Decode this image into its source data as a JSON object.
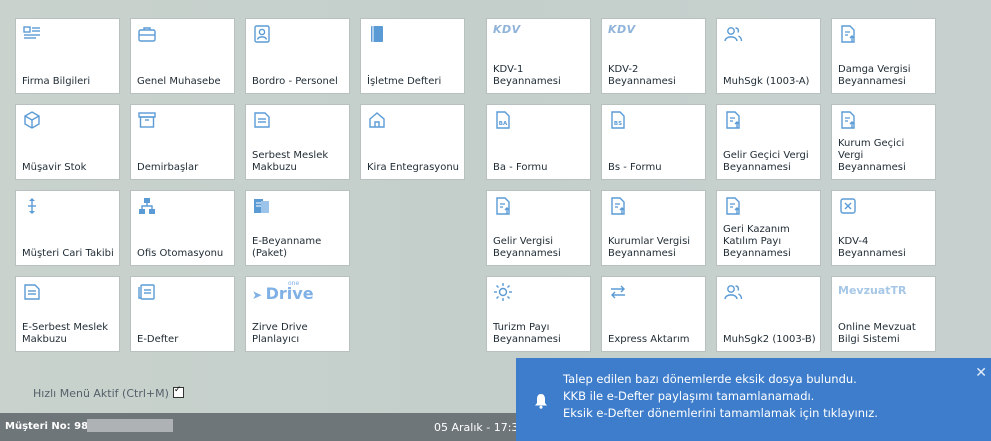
{
  "tiles_left": [
    {
      "name": "firma-bilgileri",
      "label": "Firma Bilgileri",
      "icon": "list-icon"
    },
    {
      "name": "genel-muhasebe",
      "label": "Genel Muhasebe",
      "icon": "briefcase-icon"
    },
    {
      "name": "bordro-personel",
      "label": "Bordro - Personel",
      "icon": "person-card-icon"
    },
    {
      "name": "isletme-defteri",
      "label": "İşletme Defteri",
      "icon": "notebook-icon"
    },
    {
      "name": "musavir-stok",
      "label": "Müşavir Stok",
      "icon": "box-icon"
    },
    {
      "name": "demirbaslar",
      "label": "Demirbaşlar",
      "icon": "archive-icon"
    },
    {
      "name": "serbest-meslek-makbuzu",
      "label": "Serbest Meslek\nMakbuzu",
      "icon": "receipt-icon"
    },
    {
      "name": "kira-entegrasyonu",
      "label": "Kira Entegrasyonu",
      "icon": "house-icon"
    },
    {
      "name": "musteri-cari-takibi",
      "label": "Müşteri Cari Takibi",
      "icon": "updown-arrows-icon"
    },
    {
      "name": "ofis-otomasyonu",
      "label": "Ofis Otomasyonu",
      "icon": "org-chart-icon"
    },
    {
      "name": "e-beyanname-paket",
      "label": "E-Beyanname\n(Paket)",
      "icon": "document-bundle-icon"
    },
    {
      "name": "e-serbest-meslek-makbuzu",
      "label": "E-Serbest Meslek\nMakbuzu",
      "icon": "receipt-icon"
    },
    {
      "name": "e-defter",
      "label": "E-Defter",
      "icon": "ledger-icon"
    },
    {
      "name": "zirve-drive-planlayici",
      "label": "Zirve Drive\nPlanlayıcı",
      "icon": "drive-logo",
      "logo_text": "Drive",
      "logo_small": "one"
    }
  ],
  "tiles_right": [
    {
      "name": "kdv-1-beyannamesi",
      "label": "KDV-1\nBeyannamesi",
      "icon": "kdv-logo",
      "logo_text": "KDV"
    },
    {
      "name": "kdv-2-beyannamesi",
      "label": "KDV-2\nBeyannamesi",
      "icon": "kdv-logo",
      "logo_text": "KDV"
    },
    {
      "name": "muhsgk-1003-a",
      "label": "MuhSgk (1003-A)",
      "icon": "people-icon"
    },
    {
      "name": "damga-vergisi-beyannamesi",
      "label": "Damga Vergisi\nBeyannamesi",
      "icon": "document-upload-icon"
    },
    {
      "name": "ba-formu",
      "label": "Ba - Formu",
      "icon": "ba-document-icon"
    },
    {
      "name": "bs-formu",
      "label": "Bs - Formu",
      "icon": "bs-document-icon"
    },
    {
      "name": "gelir-gecici-vergi",
      "label": "Gelir Geçici Vergi\nBeyannamesi",
      "icon": "document-upload-icon"
    },
    {
      "name": "kurum-gecici-vergi",
      "label": "Kurum Geçici Vergi\nBeyannamesi",
      "icon": "document-upload-icon"
    },
    {
      "name": "gelir-vergisi-beyannamesi",
      "label": "Gelir Vergisi\nBeyannamesi",
      "icon": "document-upload-icon"
    },
    {
      "name": "kurumlar-vergisi-beyannamesi",
      "label": "Kurumlar Vergisi\nBeyannamesi",
      "icon": "document-upload-icon"
    },
    {
      "name": "geri-kazanim-katilim-payi",
      "label": "Geri Kazanım\nKatılım Payı\nBeyannamesi",
      "icon": "document-upload-icon"
    },
    {
      "name": "kdv-4-beyannamesi",
      "label": "KDV-4\nBeyannamesi",
      "icon": "chip-icon"
    },
    {
      "name": "turizm-payi-beyannamesi",
      "label": "Turizm Payı\nBeyannamesi",
      "icon": "sun-icon"
    },
    {
      "name": "express-aktarim",
      "label": "Express Aktarım",
      "icon": "transfer-arrows-icon"
    },
    {
      "name": "muhsgk2-1003-b",
      "label": "MuhSgk2 (1003-B)",
      "icon": "people-icon"
    },
    {
      "name": "online-mevzuat",
      "label": "Online Mevzuat\nBilgi Sistemi",
      "icon": "mevzuat-logo",
      "logo_text": "MevzuatTR"
    }
  ],
  "hizli_menu": {
    "label": "Hızlı Menü Aktif (Ctrl+M)",
    "checked": true
  },
  "statusbar": {
    "musteri_label": "Müşteri No: 98",
    "date": "05 Aralık - 17:3"
  },
  "toast": {
    "lines": [
      "Talep edilen bazı dönemlerde eksik dosya bulundu.",
      "KKB ile e-Defter paylaşımı tamamlanamadı.",
      "Eksik e-Defter dönemlerini tamamlamak için tıklayınız."
    ],
    "close": "✕",
    "icon": "bell-icon"
  },
  "colors": {
    "icon": "#5b9bd5",
    "toast": "#3d7dcb",
    "statusbar": "#6f7679"
  }
}
